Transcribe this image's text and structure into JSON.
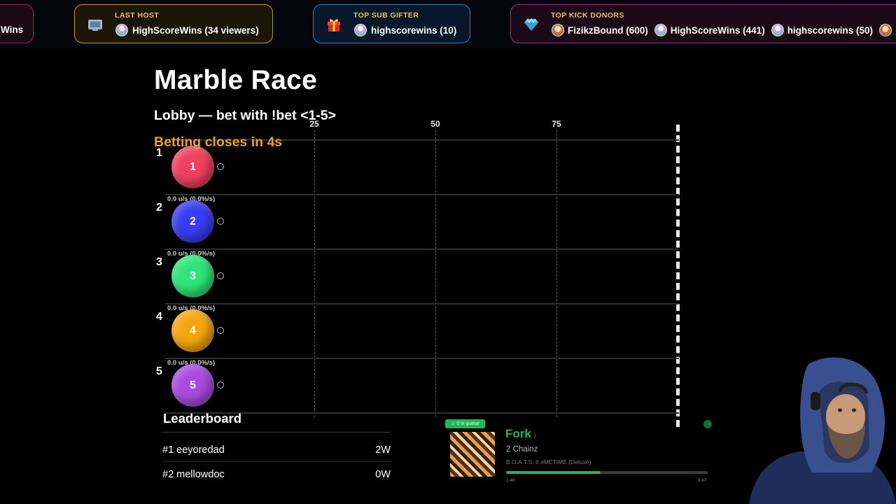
{
  "ticker": {
    "prev": {
      "name": "Wins"
    },
    "last_host": {
      "title": "LAST HOST",
      "name": "HighScoreWins (34 viewers)",
      "icon": "tv-icon"
    },
    "top_sub_gifter": {
      "title": "TOP SUB GIFTER",
      "name": "highscorewins (10)",
      "icon": "gift-icon"
    },
    "top_kick_donors": {
      "title": "TOP KICK DONORS",
      "icon": "diamond-icon",
      "donors": [
        "FizikzBound (600)",
        "HighScoreWins (441)",
        "highscorewins (50)"
      ]
    }
  },
  "race": {
    "title": "Marble Race",
    "subtitle": "Lobby — bet with !bet <1-5>",
    "status": "Betting closes in 4s",
    "ticks": [
      "25",
      "50",
      "75"
    ],
    "lanes": [
      {
        "lane": "1",
        "label": "1",
        "color": "#f0405f",
        "progress": 0
      },
      {
        "lane": "2",
        "label": "2",
        "color": "#3a3cf2",
        "progress": 0,
        "speed": "0.0 u/s (0.0%/s)"
      },
      {
        "lane": "3",
        "label": "3",
        "color": "#2fe47a",
        "progress": 0,
        "speed": "0.0 u/s (0.0%/s)"
      },
      {
        "lane": "4",
        "label": "4",
        "color": "#f5a511",
        "progress": 0,
        "speed": "0.0 u/s (0.0%/s)"
      },
      {
        "lane": "5",
        "label": "5",
        "color": "#a94be0",
        "progress": 0,
        "speed": "0.0 u/s (0.0%/s)"
      }
    ]
  },
  "leaderboard": {
    "title": "Leaderboard",
    "rows": [
      {
        "rank": "#1 eeyoredad",
        "wins": "2W"
      },
      {
        "rank": "#2 mellowdoc",
        "wins": "0W"
      }
    ]
  },
  "music": {
    "queue": "0 in queue",
    "song": "Fork",
    "artist": "2 Chainz",
    "album": "B.O.A.T.S. II #METIME (Deluxe)",
    "current_time": "1:48",
    "total_time": "3:47",
    "progress": 0.47,
    "accent": "#1db954"
  },
  "colors": {
    "host_border": "#c8962c",
    "gifter_border": "#2d7fb5",
    "kick_border": "#a02a74",
    "timer": "#f0a21c"
  }
}
